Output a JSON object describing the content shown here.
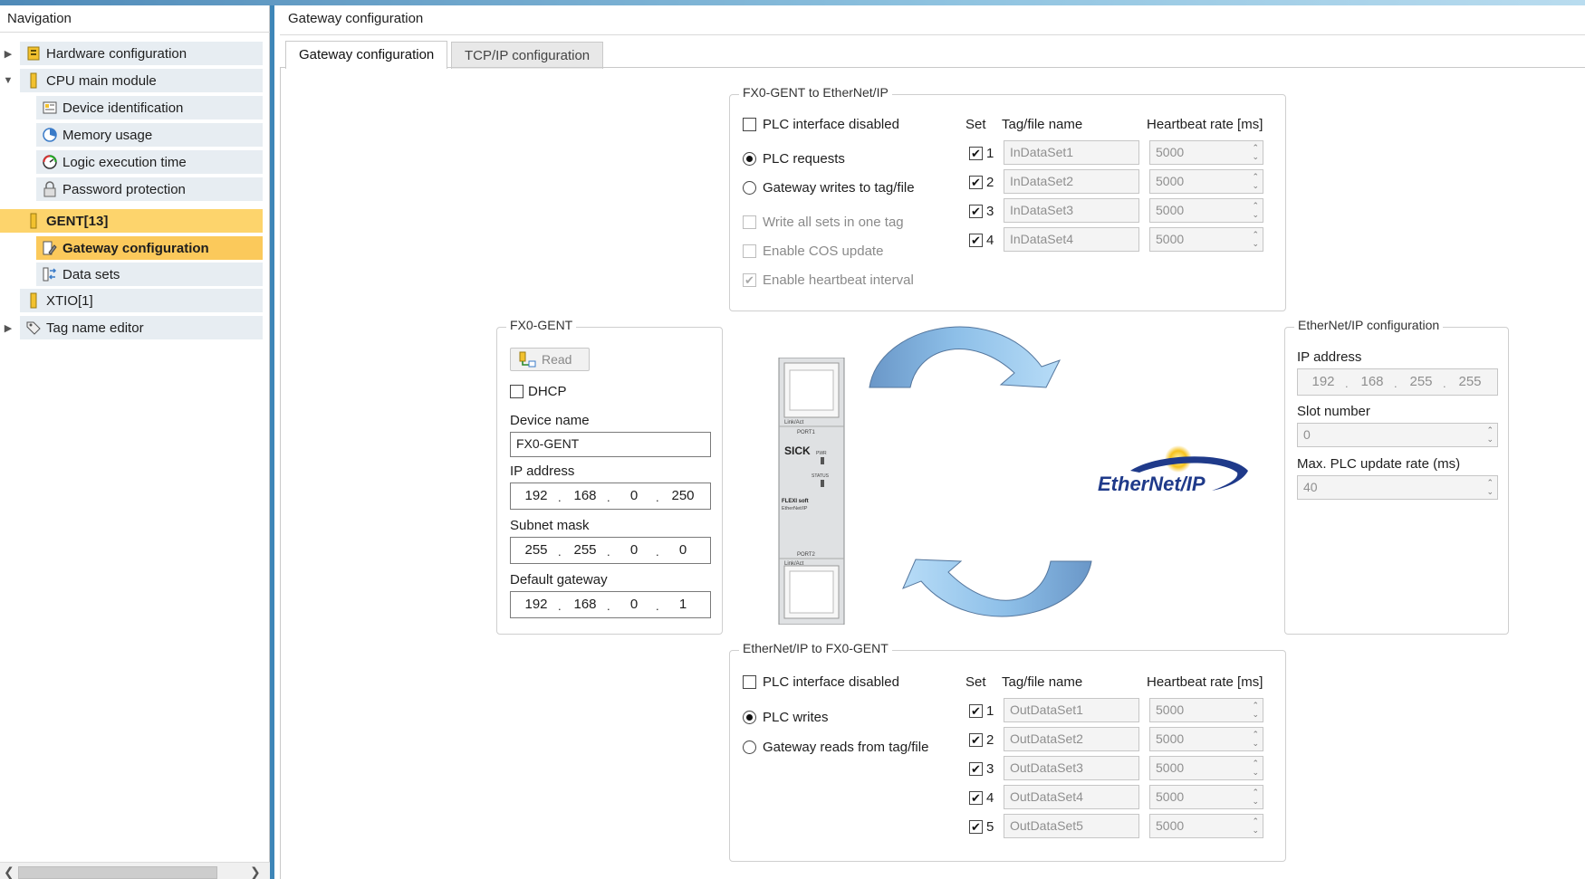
{
  "navigation": {
    "title": "Navigation",
    "items": [
      {
        "label": "Hardware configuration",
        "icon": "hardware-icon"
      },
      {
        "label": "CPU main module",
        "icon": "module-icon"
      },
      {
        "label": "Device identification",
        "icon": "device-id-icon"
      },
      {
        "label": "Memory usage",
        "icon": "pie-chart-icon"
      },
      {
        "label": "Logic execution time",
        "icon": "gauge-icon"
      },
      {
        "label": "Password protection",
        "icon": "lock-icon"
      },
      {
        "label": "GENT[13]",
        "icon": "module-icon"
      },
      {
        "label": "Gateway configuration",
        "icon": "wrench-icon"
      },
      {
        "label": "Data sets",
        "icon": "data-sets-icon"
      },
      {
        "label": "XTIO[1]",
        "icon": "module-icon"
      },
      {
        "label": "Tag name editor",
        "icon": "tag-icon"
      }
    ]
  },
  "main": {
    "title": "Gateway configuration",
    "tabs": [
      {
        "label": "Gateway configuration",
        "active": true
      },
      {
        "label": "TCP/IP configuration",
        "active": false
      }
    ]
  },
  "to_ethernetip": {
    "title": "FX0-GENT to EtherNet/IP",
    "plc_disabled_label": "PLC interface disabled",
    "plc_requests_label": "PLC requests",
    "gateway_writes_label": "Gateway writes to tag/file",
    "write_all_label": "Write all sets in one tag",
    "enable_cos_label": "Enable COS update",
    "enable_heartbeat_label": "Enable heartbeat interval",
    "col_set": "Set",
    "col_tag": "Tag/file name",
    "col_rate": "Heartbeat rate [ms]",
    "rows": [
      {
        "set": "1",
        "tag": "InDataSet1",
        "rate": "5000"
      },
      {
        "set": "2",
        "tag": "InDataSet2",
        "rate": "5000"
      },
      {
        "set": "3",
        "tag": "InDataSet3",
        "rate": "5000"
      },
      {
        "set": "4",
        "tag": "InDataSet4",
        "rate": "5000"
      }
    ]
  },
  "fx0": {
    "title": "FX0-GENT",
    "read_label": "Read",
    "dhcp_label": "DHCP",
    "device_name_label": "Device name",
    "device_name_value": "FX0-GENT",
    "ip_label": "IP address",
    "ip": [
      "192",
      "168",
      "0",
      "250"
    ],
    "subnet_label": "Subnet mask",
    "subnet": [
      "255",
      "255",
      "0",
      "0"
    ],
    "gateway_label": "Default gateway",
    "gateway": [
      "192",
      "168",
      "0",
      "1"
    ]
  },
  "device_labels": {
    "link_act_top": "Link/Act",
    "port1": "PORT1",
    "brand": "SICK",
    "pwr": "PWR",
    "status": "STATUS",
    "product_line1": "FLEXI soft",
    "product_line2": "EtherNet/IP",
    "port2": "PORT2",
    "link_act_bottom": "Link/Act"
  },
  "logo_text": "EtherNet/IP",
  "eip_config": {
    "title": "EtherNet/IP configuration",
    "ip_label": "IP address",
    "ip": [
      "192",
      "168",
      "255",
      "255"
    ],
    "slot_label": "Slot number",
    "slot_value": "0",
    "rate_label": "Max. PLC update rate (ms)",
    "rate_value": "40"
  },
  "from_ethernetip": {
    "title": "EtherNet/IP to FX0-GENT",
    "plc_disabled_label": "PLC interface disabled",
    "plc_writes_label": "PLC writes",
    "gateway_reads_label": "Gateway reads from tag/file",
    "col_set": "Set",
    "col_tag": "Tag/file name",
    "col_rate": "Heartbeat rate [ms]",
    "rows": [
      {
        "set": "1",
        "tag": "OutDataSet1",
        "rate": "5000"
      },
      {
        "set": "2",
        "tag": "OutDataSet2",
        "rate": "5000"
      },
      {
        "set": "3",
        "tag": "OutDataSet3",
        "rate": "5000"
      },
      {
        "set": "4",
        "tag": "OutDataSet4",
        "rate": "5000"
      },
      {
        "set": "5",
        "tag": "OutDataSet5",
        "rate": "5000"
      }
    ]
  },
  "colors": {
    "accent": "#3e86b8",
    "selected_item": "#fbc95b",
    "arrow_fill": "#8dbfe8",
    "arrow_dark": "#6a97c8"
  }
}
